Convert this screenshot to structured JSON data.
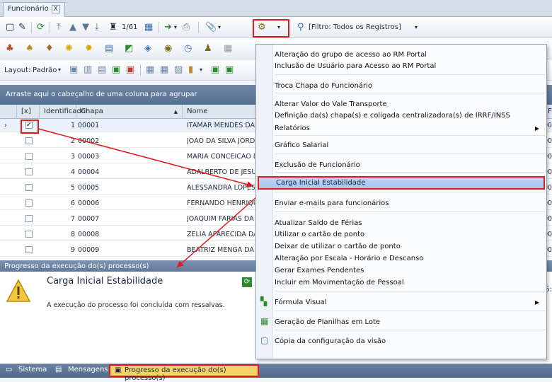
{
  "tab": {
    "label": "Funcionário",
    "close": "X"
  },
  "toolbar1": {
    "pager": "1/61",
    "filter_label": "[Filtro: Todos os Registros]"
  },
  "toolbar3": {
    "layout_label": "Layout:",
    "layout_value": "Padrão"
  },
  "grid": {
    "group_hint": "Arraste aqui o cabeçalho de uma coluna para agrupar",
    "columns": {
      "check": "[x]",
      "id": "Identificador",
      "chapa": "Chapa",
      "nome": "Nome",
      "extra": "Fur"
    },
    "rows": [
      {
        "id": "1",
        "chapa": "00001",
        "nome": "ITAMAR MENDES DA S",
        "extra": "00",
        "checked": true
      },
      {
        "id": "2",
        "chapa": "00002",
        "nome": "JOAO DA SILVA JORD",
        "extra": "00",
        "checked": false
      },
      {
        "id": "3",
        "chapa": "00003",
        "nome": "MARIA CONCEICAO D",
        "extra": "00",
        "checked": false
      },
      {
        "id": "4",
        "chapa": "00004",
        "nome": "ADALBERTO DE JESUS",
        "extra": "00",
        "checked": false
      },
      {
        "id": "5",
        "chapa": "00005",
        "nome": "ALESSANDRA LOPES D",
        "extra": "00",
        "checked": false
      },
      {
        "id": "6",
        "chapa": "00006",
        "nome": "FERNANDO HENRIQU",
        "extra": "00",
        "checked": false
      },
      {
        "id": "7",
        "chapa": "00007",
        "nome": "JOAQUIM FARIAS DA",
        "extra": "00",
        "checked": false
      },
      {
        "id": "8",
        "chapa": "00008",
        "nome": "ZELIA APARECIDA DA",
        "extra": "00",
        "checked": false
      },
      {
        "id": "9",
        "chapa": "00009",
        "nome": "BEATRIZ MENGA DA L",
        "extra": "00",
        "checked": false
      }
    ]
  },
  "progress": {
    "panel_title": "Progresso da execução do(s) processo(s)",
    "process_name": "Carga Inicial Estabilidade",
    "message": "A execução do processo foi concluída com ressalvas.",
    "right_value": "6:"
  },
  "menu": {
    "items": [
      "Alteração do grupo de acesso ao RM Portal",
      "Inclusão de Usuário para Acesso ao RM Portal",
      "Troca Chapa do Funcionário",
      "Alterar Valor do Vale Transporte",
      "Definição da(s) chapa(s)  e coligada centralizadora(s) de IRRF/INSS",
      "Relatórios",
      "Gráfico Salarial",
      "Exclusão de Funcionário",
      "Carga Inicial Estabilidade",
      "Enviar e-mails para funcionários",
      "Atualizar Saldo de Férias",
      "Utilizar o cartão de ponto",
      "Deixar de utilizar o cartão de ponto",
      "Alteração por Escala - Horário e Descanso",
      "Gerar Exames Pendentes",
      "Incluir em Movimentação de Pessoal",
      "Fórmula Visual",
      "Geração de Planilhas em Lote",
      "Cópia da configuração da visão"
    ]
  },
  "statusbar": {
    "sistema": "Sistema",
    "mensagens": "Mensagens",
    "progresso": "Progresso da execução do(s) processo(s)"
  },
  "colors": {
    "accent": "#e0191a",
    "highlight": "#bfd5f3",
    "header": "#55708f"
  }
}
